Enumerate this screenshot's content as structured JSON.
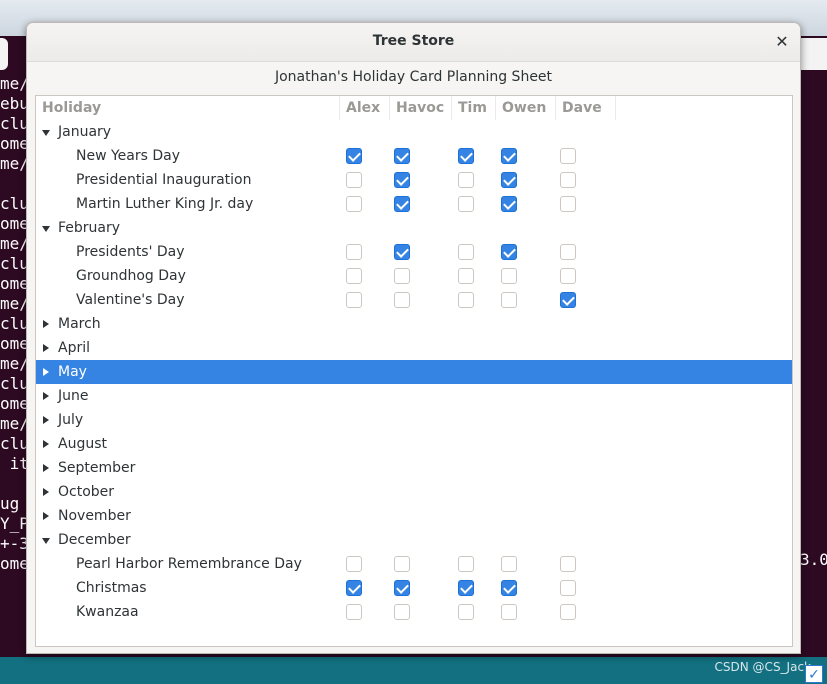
{
  "window": {
    "title": "Tree Store",
    "close_icon": "close-icon"
  },
  "sheet_title": "Jonathan's Holiday Card Planning Sheet",
  "columns": [
    "Holiday",
    "Alex",
    "Havoc",
    "Tim",
    "Owen",
    "Dave"
  ],
  "months": [
    {
      "name": "January",
      "expanded": true,
      "selected": false,
      "holidays": [
        {
          "name": "New Years Day",
          "checks": [
            true,
            true,
            true,
            true,
            false
          ]
        },
        {
          "name": "Presidential Inauguration",
          "checks": [
            false,
            true,
            false,
            true,
            false
          ]
        },
        {
          "name": "Martin Luther King Jr. day",
          "checks": [
            false,
            true,
            false,
            true,
            false
          ]
        }
      ]
    },
    {
      "name": "February",
      "expanded": true,
      "selected": false,
      "holidays": [
        {
          "name": "Presidents' Day",
          "checks": [
            false,
            true,
            false,
            true,
            false
          ]
        },
        {
          "name": "Groundhog Day",
          "checks": [
            false,
            false,
            false,
            false,
            false
          ]
        },
        {
          "name": "Valentine's Day",
          "checks": [
            false,
            false,
            false,
            false,
            true
          ]
        }
      ]
    },
    {
      "name": "March",
      "expanded": false,
      "selected": false,
      "holidays": []
    },
    {
      "name": "April",
      "expanded": false,
      "selected": false,
      "holidays": []
    },
    {
      "name": "May",
      "expanded": false,
      "selected": true,
      "holidays": []
    },
    {
      "name": "June",
      "expanded": false,
      "selected": false,
      "holidays": []
    },
    {
      "name": "July",
      "expanded": false,
      "selected": false,
      "holidays": []
    },
    {
      "name": "August",
      "expanded": false,
      "selected": false,
      "holidays": []
    },
    {
      "name": "September",
      "expanded": false,
      "selected": false,
      "holidays": []
    },
    {
      "name": "October",
      "expanded": false,
      "selected": false,
      "holidays": []
    },
    {
      "name": "November",
      "expanded": false,
      "selected": false,
      "holidays": []
    },
    {
      "name": "December",
      "expanded": true,
      "selected": false,
      "holidays": [
        {
          "name": "Pearl Harbor Remembrance Day",
          "checks": [
            false,
            false,
            false,
            false,
            false
          ]
        },
        {
          "name": "Christmas",
          "checks": [
            true,
            true,
            true,
            true,
            false
          ]
        },
        {
          "name": "Kwanzaa",
          "checks": [
            false,
            false,
            false,
            false,
            false
          ]
        }
      ]
    }
  ],
  "background_terminal": {
    "left_fragments": [
      "me/",
      "ebu",
      "clu",
      "ome",
      "me/",
      "",
      "clu",
      "ome",
      "me/",
      "clu",
      "ome",
      "me/",
      "clu",
      "ome",
      "me/",
      "clu",
      "ome",
      "me/",
      "clu",
      " it",
      "",
      "ug",
      "Y_P",
      "+-3",
      "ome"
    ],
    "right_fragment": "3.0"
  },
  "taskbar": {
    "watermark": "CSDN @CS_Jack",
    "tray_icon": "checkbox-tray-icon"
  },
  "colors": {
    "accent": "#3584e4",
    "terminal_bg": "#2d0922",
    "taskbar": "#127080"
  }
}
